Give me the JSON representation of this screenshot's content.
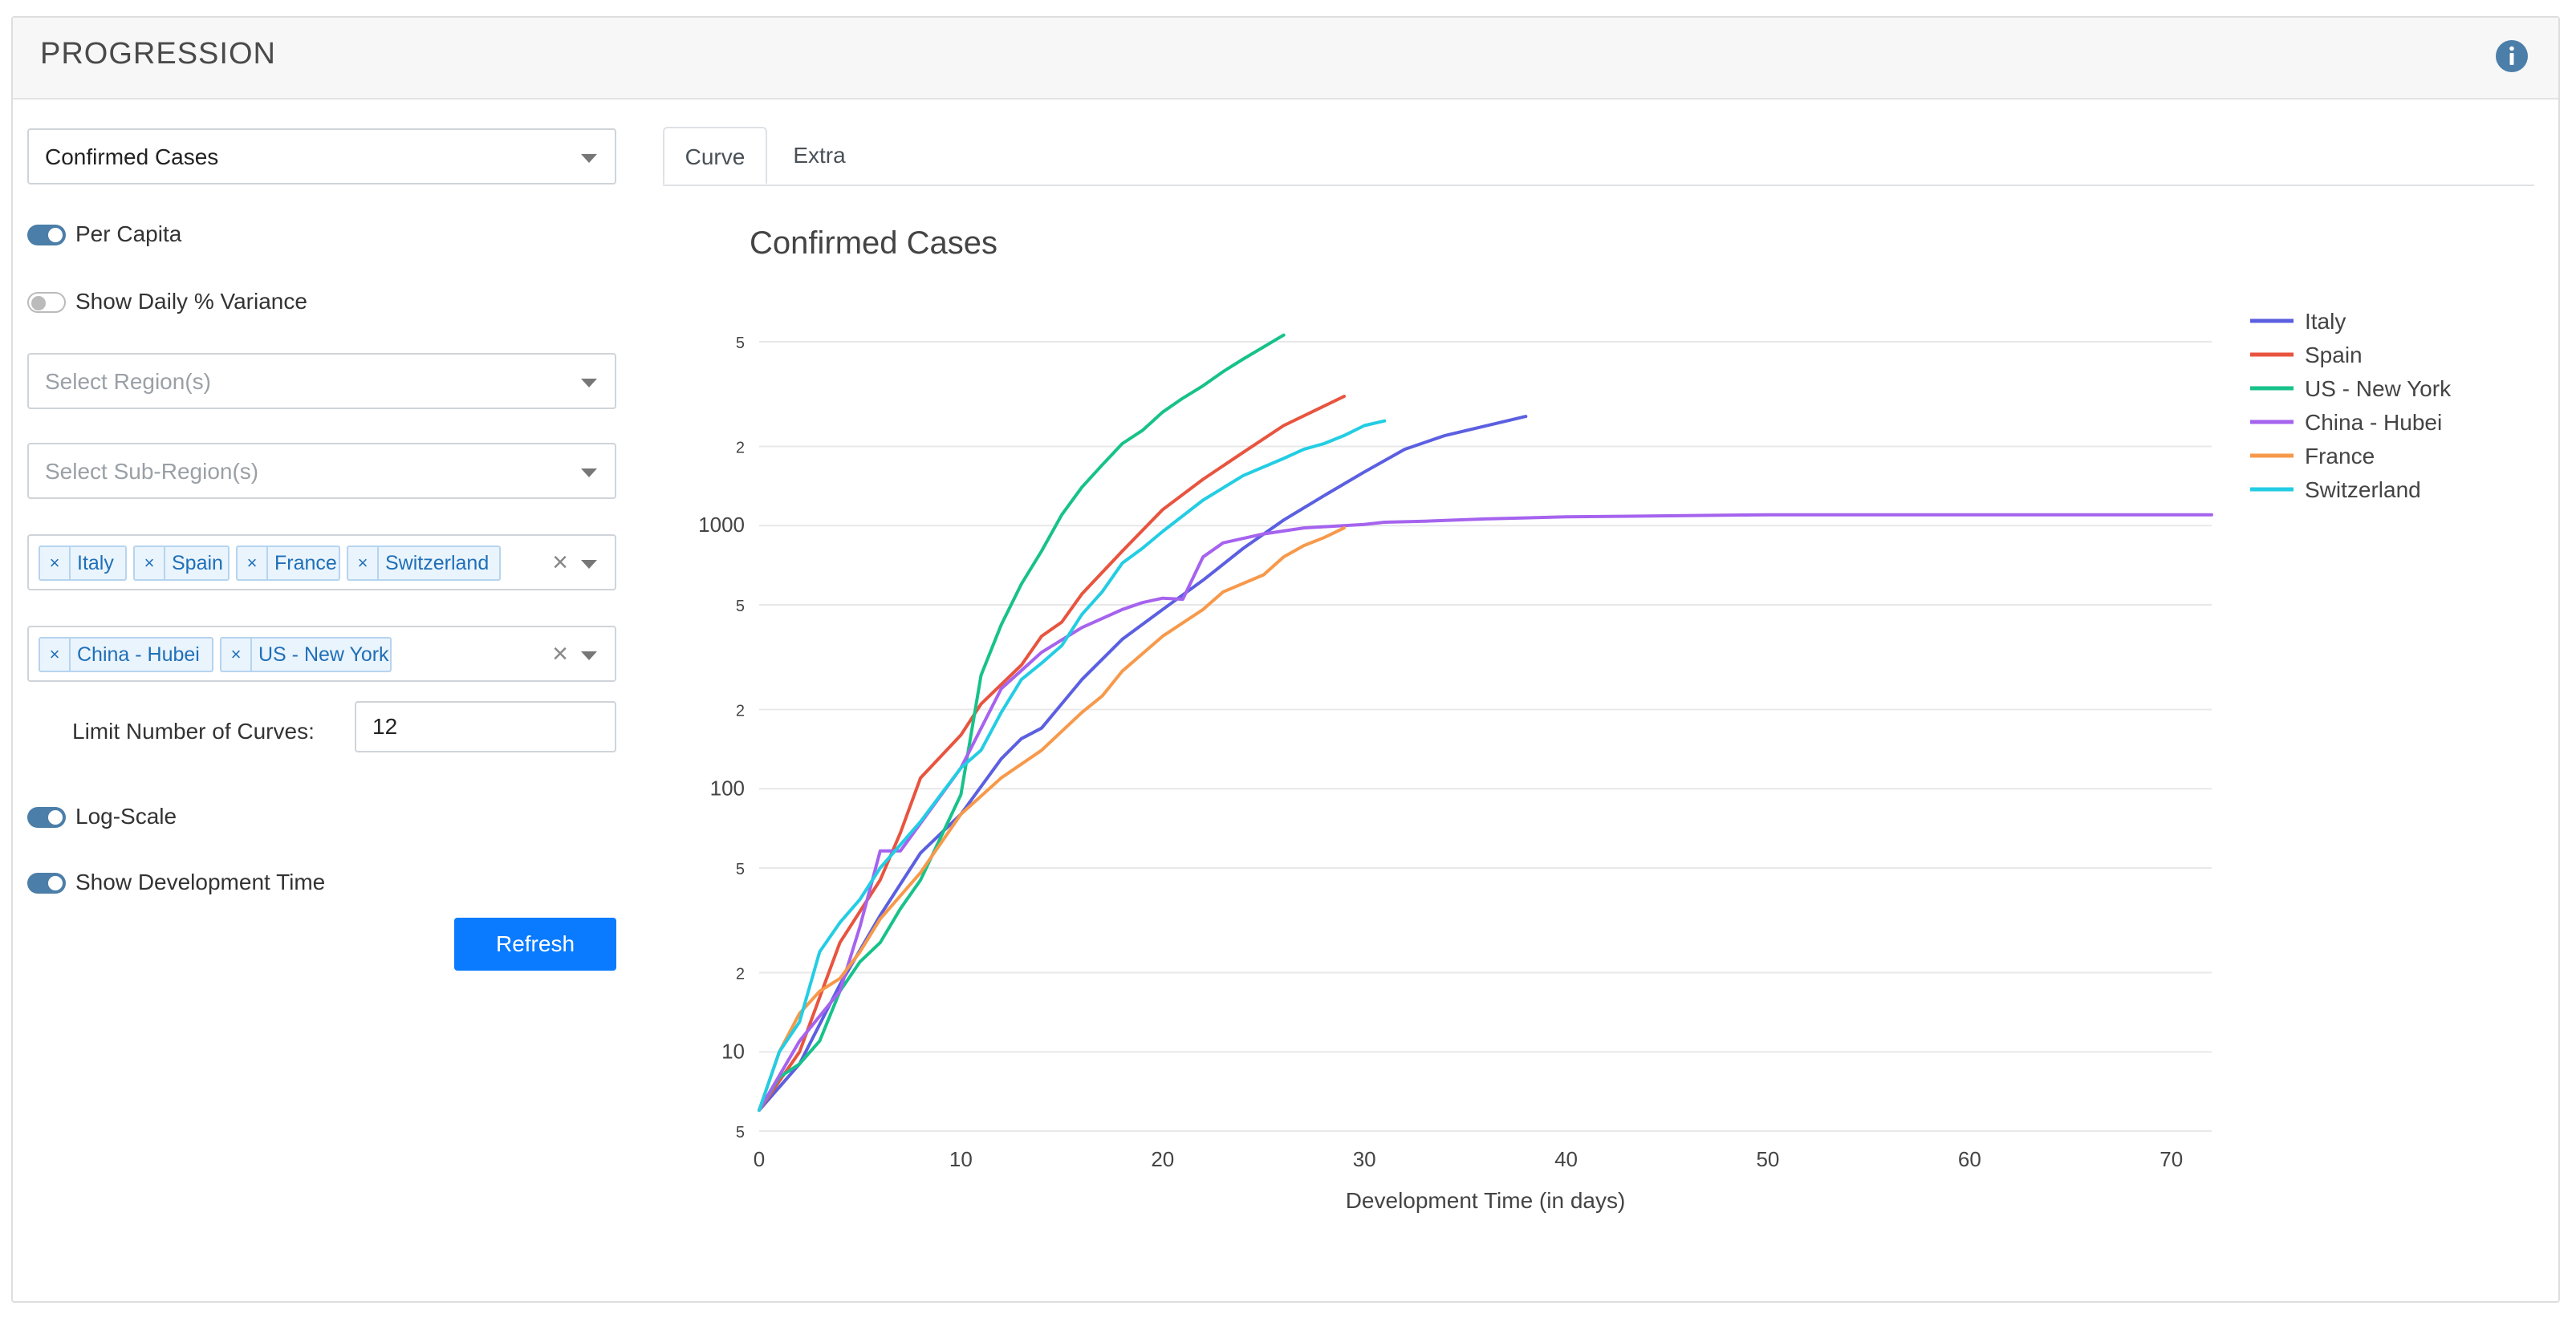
{
  "header": {
    "title": "PROGRESSION",
    "info_icon": "info-icon"
  },
  "controls": {
    "metric_select": {
      "value": "Confirmed Cases"
    },
    "per_capita": {
      "label": "Per Capita",
      "on": true
    },
    "daily_variance": {
      "label": "Show Daily % Variance",
      "on": false
    },
    "region_select": {
      "placeholder": "Select Region(s)"
    },
    "subregion_select": {
      "placeholder": "Select Sub-Region(s)"
    },
    "regions": [
      "Italy",
      "Spain",
      "France",
      "Switzerland"
    ],
    "subregions": [
      "China - Hubei",
      "US - New York"
    ],
    "clear_symbol": "×",
    "tag_remove_symbol": "×",
    "limit": {
      "label": "Limit Number of Curves:",
      "value": "12"
    },
    "log_scale": {
      "label": "Log-Scale",
      "on": true
    },
    "dev_time": {
      "label": "Show Development Time",
      "on": true
    },
    "refresh_label": "Refresh"
  },
  "tabs": [
    "Curve",
    "Extra"
  ],
  "chart_data": {
    "type": "line",
    "title": "Confirmed Cases",
    "xlabel": "Development Time (in days)",
    "ylabel": "",
    "x_ticks": [
      "0",
      "10",
      "20",
      "30",
      "40",
      "50",
      "60",
      "70"
    ],
    "y_scale": "log",
    "xlim": [
      0,
      72
    ],
    "ylim": [
      5,
      6000
    ],
    "y_ticks": [
      {
        "v": 5,
        "label": "5",
        "major": false
      },
      {
        "v": 10,
        "label": "10",
        "major": true
      },
      {
        "v": 20,
        "label": "2",
        "major": false
      },
      {
        "v": 50,
        "label": "5",
        "major": false
      },
      {
        "v": 100,
        "label": "100",
        "major": true
      },
      {
        "v": 200,
        "label": "2",
        "major": false
      },
      {
        "v": 500,
        "label": "5",
        "major": false
      },
      {
        "v": 1000,
        "label": "1000",
        "major": true
      },
      {
        "v": 2000,
        "label": "2",
        "major": false
      },
      {
        "v": 5000,
        "label": "5",
        "major": false
      }
    ],
    "grid": true,
    "legend_position": "top-right",
    "series": [
      {
        "name": "Italy",
        "color": "#5b5fe0",
        "x": [
          0,
          2,
          4,
          6,
          8,
          10,
          12,
          13,
          14,
          16,
          18,
          20,
          22,
          24,
          26,
          28,
          30,
          32,
          34,
          38
        ],
        "y": [
          6,
          9,
          18,
          33,
          57,
          80,
          130,
          155,
          170,
          260,
          370,
          480,
          620,
          820,
          1050,
          1300,
          1600,
          1950,
          2200,
          2600
        ]
      },
      {
        "name": "Spain",
        "color": "#e8543f",
        "x": [
          0,
          2,
          4,
          6,
          7,
          8,
          10,
          11,
          13,
          14,
          15,
          16,
          18,
          20,
          22,
          24,
          26,
          29
        ],
        "y": [
          6,
          10,
          26,
          45,
          68,
          110,
          160,
          210,
          295,
          380,
          430,
          550,
          800,
          1150,
          1500,
          1900,
          2400,
          3100
        ]
      },
      {
        "name": "US - New York",
        "color": "#17c28a",
        "x": [
          0,
          1,
          2,
          3,
          4,
          5,
          6,
          7,
          8,
          10,
          11,
          12,
          13,
          14,
          15,
          16,
          17,
          18,
          19,
          20,
          21,
          22,
          23,
          24,
          26
        ],
        "y": [
          6,
          8,
          9,
          11,
          17,
          22,
          26,
          35,
          45,
          95,
          270,
          420,
          600,
          800,
          1100,
          1400,
          1700,
          2050,
          2300,
          2700,
          3050,
          3400,
          3850,
          4300,
          5300
        ]
      },
      {
        "name": "China - Hubei",
        "color": "#a563ee",
        "x": [
          0,
          2,
          4,
          5,
          6,
          7,
          10,
          12,
          14,
          16,
          18,
          19,
          20,
          21,
          22,
          23,
          25,
          27,
          30,
          31,
          33,
          36,
          40,
          50,
          60,
          72
        ],
        "y": [
          6,
          11,
          17,
          30,
          58,
          58,
          120,
          240,
          330,
          410,
          480,
          510,
          530,
          525,
          760,
          860,
          930,
          980,
          1010,
          1030,
          1040,
          1060,
          1080,
          1100,
          1100,
          1100
        ]
      },
      {
        "name": "France",
        "color": "#f7994a",
        "x": [
          0,
          1,
          2,
          3,
          4,
          5,
          6,
          8,
          10,
          12,
          14,
          16,
          17,
          18,
          20,
          22,
          23,
          25,
          26,
          27,
          28,
          29
        ],
        "y": [
          6,
          10,
          14,
          17,
          19,
          24,
          32,
          48,
          80,
          110,
          140,
          195,
          225,
          280,
          380,
          480,
          560,
          650,
          760,
          840,
          900,
          980
        ]
      },
      {
        "name": "Switzerland",
        "color": "#23cde3",
        "x": [
          0,
          1,
          2,
          3,
          4,
          5,
          6,
          8,
          9,
          10,
          11,
          12,
          13,
          14,
          15,
          16,
          17,
          18,
          19,
          20,
          22,
          24,
          26,
          27,
          28,
          29,
          30,
          31
        ],
        "y": [
          6,
          10,
          13,
          24,
          31,
          38,
          50,
          75,
          95,
          120,
          140,
          195,
          260,
          300,
          350,
          460,
          560,
          720,
          820,
          950,
          1250,
          1550,
          1800,
          1950,
          2050,
          2200,
          2400,
          2500
        ]
      }
    ]
  }
}
